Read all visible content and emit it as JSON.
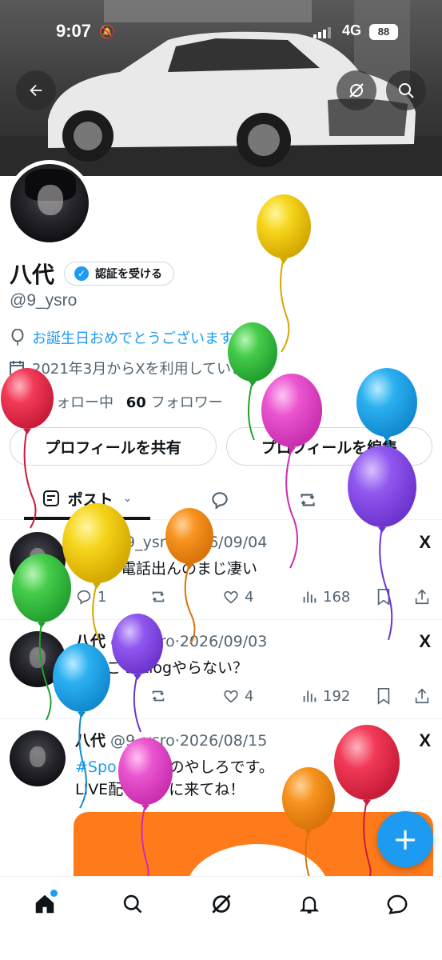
{
  "status_bar": {
    "time": "9:07",
    "network": "4G",
    "battery": "88"
  },
  "profile": {
    "name": "八代",
    "verify_label": "認証を受ける",
    "handle": "@9_ysro",
    "birthday_text": "お誕生日おめでとうございます",
    "joined_text": "2021年3月からXを利用しています",
    "following_count": "",
    "following_label": "フォロー中",
    "followers_count": "60",
    "followers_label": "フォロワー",
    "share_label": "プロフィールを共有",
    "edit_label": "プロフィールを編集"
  },
  "tabs": {
    "posts_label": "ポスト"
  },
  "posts": [
    {
      "author": "八代",
      "handle": "@9_ysro",
      "date": "2026/09/04",
      "text": "反射で電話出んのまじ凄い",
      "replies": "1",
      "reposts": "",
      "likes": "4",
      "views": "168"
    },
    {
      "author": "八代",
      "handle": "@9_ysro",
      "date": "2026/09/03",
      "text": "ーーこ setlogやらない？",
      "replies": "",
      "reposts": "",
      "likes": "4",
      "views": "192"
    },
    {
      "author": "八代",
      "handle": "@9_ysro",
      "date": "2026/08/15",
      "hashtag": "#Spo",
      "text_line1": "のやしろです。",
      "text_line2": "LIVE配　遊びに来てね！"
    }
  ],
  "colors": {
    "accent": "#1d9bf0",
    "text": "#0f1419",
    "secondary": "#536471",
    "border": "#cfd9de"
  },
  "icons": {
    "back": "back-arrow-icon",
    "grok": "grok-icon",
    "search": "search-icon",
    "birthday": "balloon-icon",
    "calendar": "calendar-icon",
    "home": "home-icon",
    "notifications": "bell-icon",
    "messages": "message-icon",
    "compose": "plus-icon"
  },
  "fab_label": "+",
  "x_logo": "X"
}
